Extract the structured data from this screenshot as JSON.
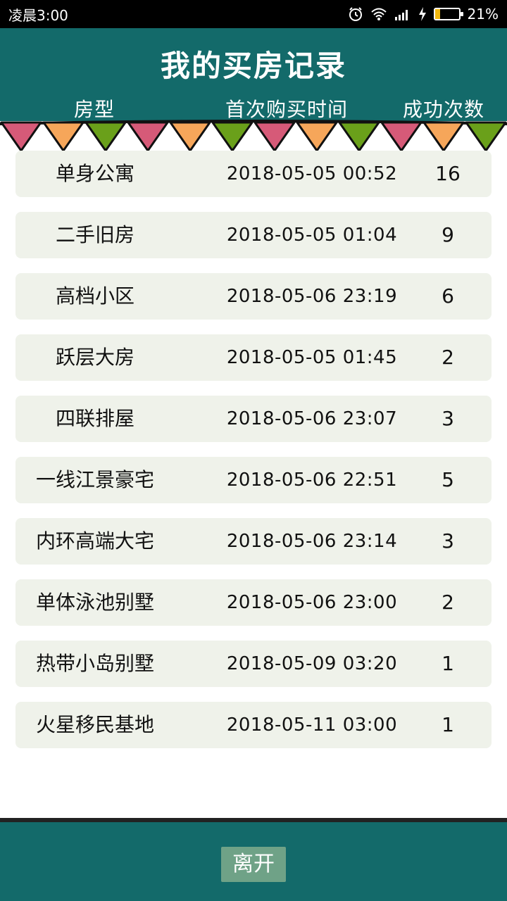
{
  "status_bar": {
    "time": "凌晨3:00",
    "battery_text": "21%",
    "battery_level": 0.21,
    "icons": [
      "alarm-icon",
      "wifi-icon",
      "signal-icon",
      "charging-icon",
      "battery-icon"
    ]
  },
  "header": {
    "title": "我的买房记录",
    "columns": [
      "房型",
      "首次购买时间",
      "成功次数"
    ]
  },
  "records": [
    {
      "name": "单身公寓",
      "time": "2018-05-05 00:52",
      "count": "16"
    },
    {
      "name": "二手旧房",
      "time": "2018-05-05 01:04",
      "count": "9"
    },
    {
      "name": "高档小区",
      "time": "2018-05-06 23:19",
      "count": "6"
    },
    {
      "name": "跃层大房",
      "time": "2018-05-05 01:45",
      "count": "2"
    },
    {
      "name": "四联排屋",
      "time": "2018-05-06 23:07",
      "count": "3"
    },
    {
      "name": "一线江景豪宅",
      "time": "2018-05-06 22:51",
      "count": "5"
    },
    {
      "name": "内环高端大宅",
      "time": "2018-05-06 23:14",
      "count": "3"
    },
    {
      "name": "单体泳池别墅",
      "time": "2018-05-06 23:00",
      "count": "2"
    },
    {
      "name": "热带小岛别墅",
      "time": "2018-05-09 03:20",
      "count": "1"
    },
    {
      "name": "火星移民基地",
      "time": "2018-05-11 03:00",
      "count": "1"
    }
  ],
  "footer": {
    "leave_label": "离开"
  },
  "colors": {
    "header_bg": "#136a6a",
    "row_bg": "#eff2ea",
    "button_bg": "#6fa287",
    "flag_pink": "#d65a78",
    "flag_orange": "#f6a65a",
    "flag_green": "#6aa01a"
  }
}
